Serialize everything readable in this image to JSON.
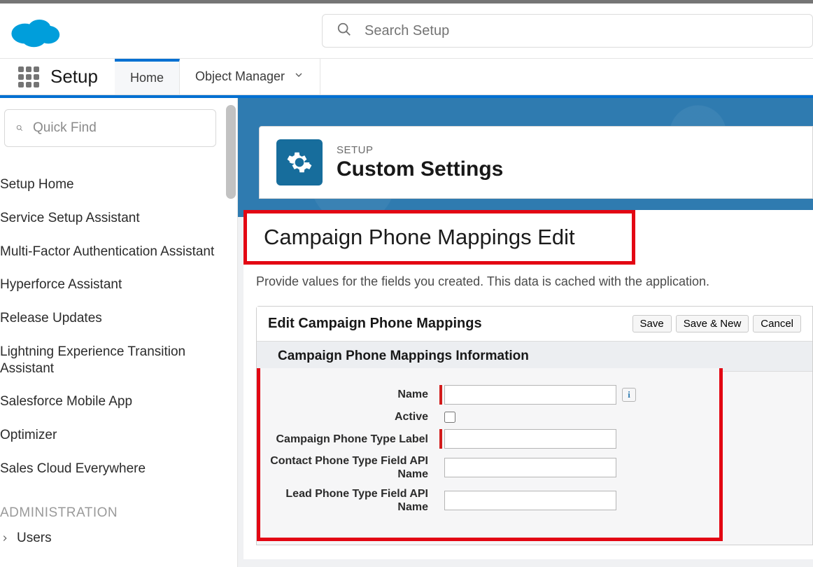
{
  "topbar": {
    "search_placeholder": "Search Setup"
  },
  "appnav": {
    "title": "Setup",
    "tab_home": "Home",
    "tab_objmgr": "Object Manager"
  },
  "sidebar": {
    "quickfind_placeholder": "Quick Find",
    "items": [
      "Setup Home",
      "Service Setup Assistant",
      "Multi-Factor Authentication Assistant",
      "Hyperforce Assistant",
      "Release Updates",
      "Lightning Experience Transition Assistant",
      "Salesforce Mobile App",
      "Optimizer",
      "Sales Cloud Everywhere"
    ],
    "section_admin": "ADMINISTRATION",
    "users": "Users"
  },
  "header": {
    "eyebrow": "SETUP",
    "title": "Custom Settings"
  },
  "page": {
    "title": "Campaign Phone Mappings Edit",
    "subtitle": "Provide values for the fields you created. This data is cached with the application."
  },
  "form": {
    "card_title": "Edit Campaign Phone Mappings",
    "btn_save": "Save",
    "btn_save_new": "Save & New",
    "btn_cancel": "Cancel",
    "section_title": "Campaign Phone Mappings Information",
    "fields": {
      "name": "Name",
      "active": "Active",
      "cp_type_label": "Campaign Phone Type Label",
      "contact_api": "Contact Phone Type Field API Name",
      "lead_api": "Lead Phone Type Field API Name"
    },
    "info_icon": "i",
    "values": {
      "name": "",
      "active": false,
      "cp_type_label": "",
      "contact_api": "",
      "lead_api": ""
    }
  }
}
